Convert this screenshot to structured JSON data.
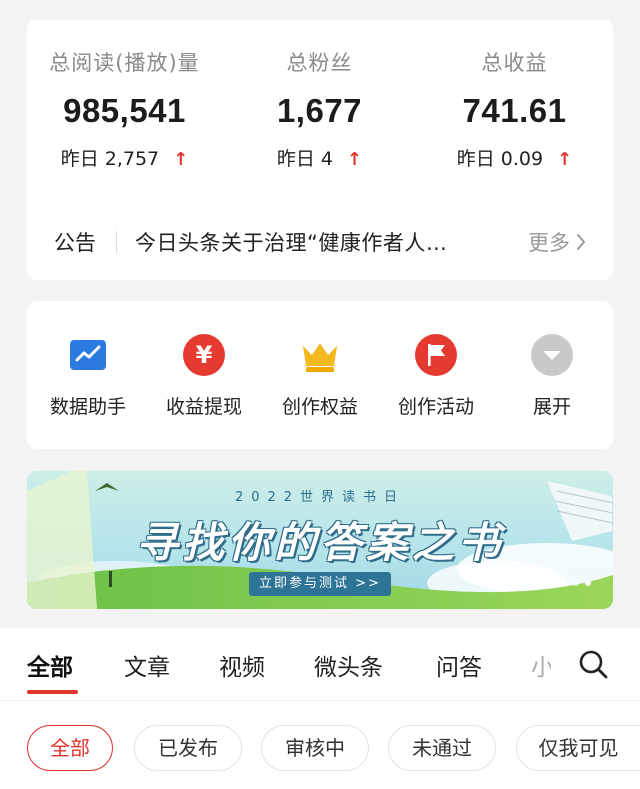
{
  "stats": [
    {
      "label": "总阅读(播放)量",
      "value": "985,541",
      "yesterday_label": "昨日",
      "yesterday_value": "2,757",
      "trend": "up"
    },
    {
      "label": "总粉丝",
      "value": "1,677",
      "yesterday_label": "昨日",
      "yesterday_value": "4",
      "trend": "up"
    },
    {
      "label": "总收益",
      "value": "741.61",
      "yesterday_label": "昨日",
      "yesterday_value": "0.09",
      "trend": "up"
    }
  ],
  "notice": {
    "title": "公告",
    "text": "今日头条关于治理“健康作者人…",
    "more": "更多"
  },
  "tools": [
    {
      "label": "数据助手",
      "icon": "chart-icon",
      "color": "#2a7ae2"
    },
    {
      "label": "收益提现",
      "icon": "yuan-icon",
      "color": "#e53a30"
    },
    {
      "label": "创作权益",
      "icon": "crown-icon",
      "color": "#f4b820"
    },
    {
      "label": "创作活动",
      "icon": "flag-icon",
      "color": "#e53a30"
    },
    {
      "label": "展开",
      "icon": "chevron-down-icon",
      "color": "#bdbdbd"
    }
  ],
  "banner": {
    "subtitle": "2022世界读书日",
    "title": "寻找你的答案之书",
    "button": "立即参与测试 >>",
    "slides": 4,
    "active_slide": 4
  },
  "tabs": [
    "全部",
    "文章",
    "视频",
    "微头条",
    "问答",
    "小"
  ],
  "active_tab": 0,
  "filters": [
    "全部",
    "已发布",
    "审核中",
    "未通过",
    "仅我可见"
  ],
  "active_filter": 0,
  "colors": {
    "accent": "#e0352b",
    "background": "#f3f3f3",
    "card": "#ffffff"
  }
}
